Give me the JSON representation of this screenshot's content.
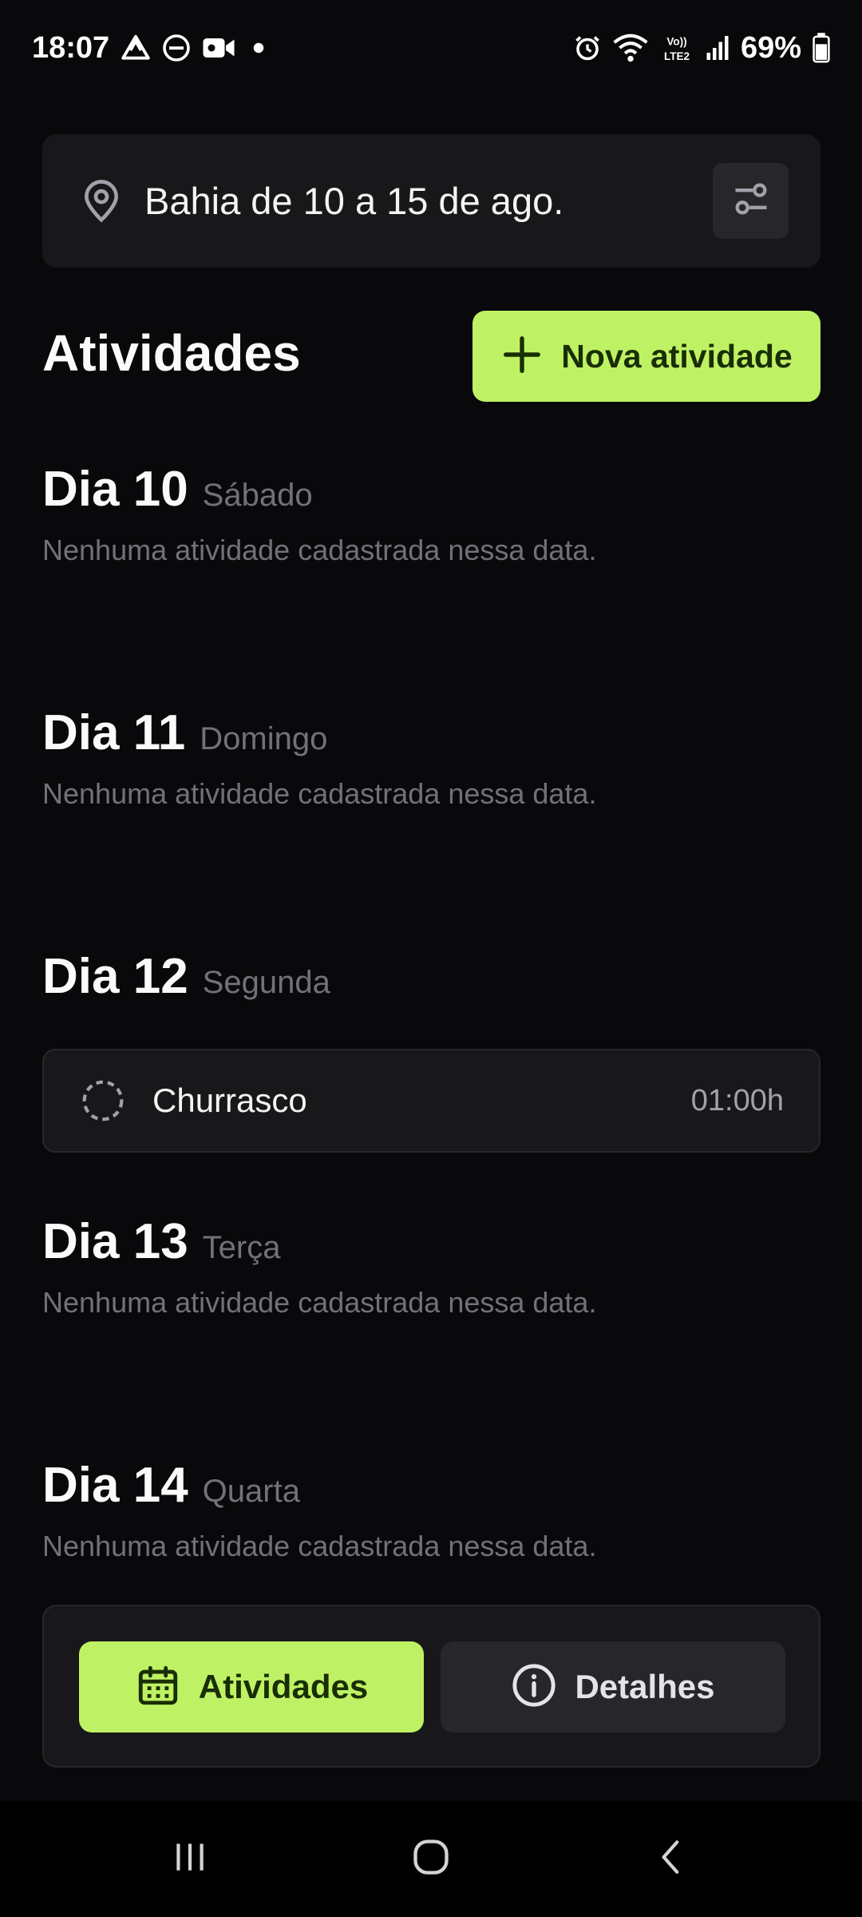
{
  "status_bar": {
    "time": "18:07",
    "battery": "69%",
    "left_icons": [
      "drive-icon",
      "dnd-icon",
      "video-icon",
      "dot-icon"
    ],
    "right_icons": [
      "alarm-icon",
      "wifi-icon",
      "volte-icon",
      "signal-icon",
      "battery-icon"
    ],
    "volte_label": "VoLTE2"
  },
  "location": {
    "text": "Bahia de 10 a 15 de ago.",
    "pin_icon": "map-pin-icon",
    "settings_icon": "settings-sliders-icon"
  },
  "header": {
    "title": "Atividades",
    "new_activity_label": "Nova atividade",
    "new_activity_icon": "plus-icon"
  },
  "days": [
    {
      "number": "Dia 10",
      "weekday": "Sábado",
      "empty_text": "Nenhuma atividade cadastrada nessa data."
    },
    {
      "number": "Dia 11",
      "weekday": "Domingo",
      "empty_text": "Nenhuma atividade cadastrada nessa data."
    },
    {
      "number": "Dia 12",
      "weekday": "Segunda",
      "empty_text": ""
    },
    {
      "number": "Dia 13",
      "weekday": "Terça",
      "empty_text": "Nenhuma atividade cadastrada nessa data."
    },
    {
      "number": "Dia 14",
      "weekday": "Quarta",
      "empty_text": "Nenhuma atividade cadastrada nessa data."
    }
  ],
  "activities": [
    {
      "name": "Churrasco",
      "duration": "01:00h",
      "status_icon": "circle-dashed-icon"
    }
  ],
  "tabs": {
    "activities": {
      "label": "Atividades",
      "icon": "calendar-icon",
      "active": true
    },
    "details": {
      "label": "Detalhes",
      "icon": "info-icon",
      "active": false
    }
  },
  "colors": {
    "background": "#09090b",
    "card": "#18181b",
    "accent": "#bef264",
    "muted_text": "#71717a"
  },
  "nav_bar": {
    "recent_icon": "recent-apps-icon",
    "home_icon": "home-icon",
    "back_icon": "back-icon"
  }
}
